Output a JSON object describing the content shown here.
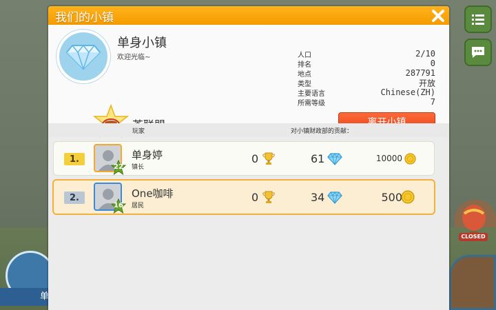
{
  "window": {
    "title": "我们的小镇"
  },
  "town": {
    "name": "单身小镇",
    "welcome": "欢迎光临~",
    "league": "茶联盟",
    "stats": [
      {
        "label": "人口",
        "value": "2/10"
      },
      {
        "label": "排名",
        "value": "0"
      },
      {
        "label": "地点",
        "value": "287791"
      },
      {
        "label": "类型",
        "value": "开放"
      },
      {
        "label": "主要语言",
        "value": "Chinese(ZH)"
      },
      {
        "label": "所需等级",
        "value": "7"
      }
    ],
    "leave_button": "离开小镇"
  },
  "list": {
    "header_player": "玩家",
    "header_contribution": "对小镇财政部的贡献："
  },
  "members": [
    {
      "rank": "1.",
      "name": "单身婷",
      "role": "镇长",
      "level": "22",
      "trophies": "0",
      "diamonds": "61",
      "coins": "10000"
    },
    {
      "rank": "2.",
      "name": "One咖啡",
      "role": "居民",
      "level": "16",
      "trophies": "0",
      "diamonds": "34",
      "coins": "500"
    }
  ],
  "background": {
    "closed_label": "CLOSED"
  },
  "colors": {
    "title_bar": "#f59b00",
    "leave_button": "#e5431a",
    "highlight_border": "#f3b03a"
  }
}
